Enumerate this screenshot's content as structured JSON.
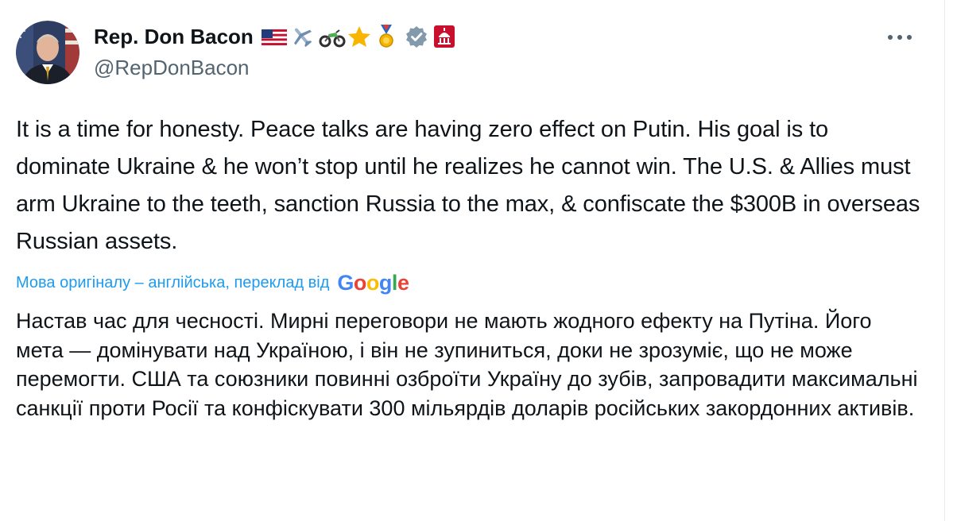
{
  "author": {
    "display_name": "Rep. Don Bacon",
    "handle": "@RepDonBacon",
    "badges": [
      "us-flag-icon",
      "airplane-icon",
      "motorcycle-icon",
      "star-icon",
      "medal-icon",
      "verified-icon",
      "capitol-icon"
    ]
  },
  "tweet": {
    "text": "It is a time for honesty. Peace talks are having zero effect on Putin. His goal is to dominate Ukraine & he won’t stop until he realizes he cannot win. The U.S. & Allies must arm Ukraine to the teeth, sanction Russia to the max, & confiscate the $300B in overseas Russian assets."
  },
  "translation": {
    "label": "Мова оригіналу – англійська, переклад від",
    "provider": "Google",
    "text": "Настав час для чесності. Мирні переговори не мають жодного ефекту на Путіна. Його мета — домінувати над Україною, і він не зупиниться, доки не зрозуміє, що не може перемогти. США та союзники повинні озброїти Україну до зубів, запровадити максимальні санкції проти Росії та конфіскувати 300 мільярдів доларів російських закордонних активів."
  },
  "colors": {
    "link": "#1d9bf0",
    "secondary_text": "#536471",
    "verified": "#829aab"
  }
}
